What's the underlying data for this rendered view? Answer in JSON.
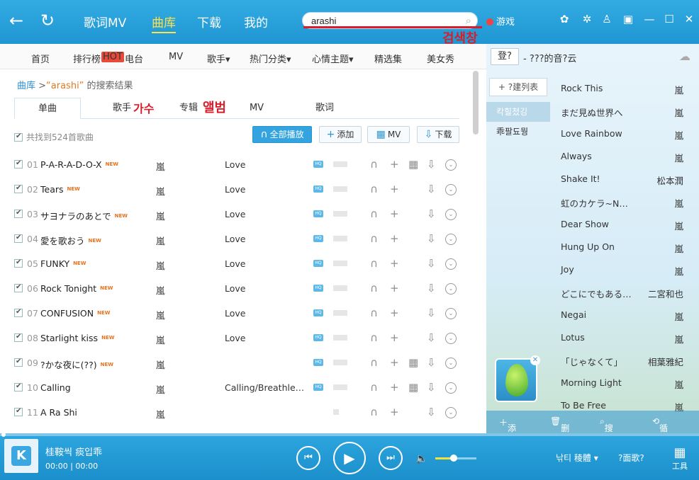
{
  "topbar": {
    "tabs": [
      "歌词MV",
      "曲库",
      "下载",
      "我的"
    ],
    "active_tab": "曲库",
    "search_value": "arashi",
    "annotation_search": "검색창",
    "games_label": "游戏"
  },
  "category_nav": [
    "首页",
    "排行榜",
    "电台",
    "MV",
    "歌手▾",
    "热门分类▾",
    "心情主题▾",
    "精选集",
    "美女秀"
  ],
  "hot_badge": "HOT",
  "breadcrumb": {
    "root": "曲库",
    "sep": " >",
    "keyword": "“arashi”",
    "suffix": " 的搜索结果"
  },
  "sub_tabs": [
    "单曲",
    "歌手",
    "专辑",
    "MV",
    "歌词"
  ],
  "annotation_artist": "가수",
  "annotation_album": "앨범",
  "toolbar": {
    "found": "共找到524首歌曲",
    "play_all": "全部播放",
    "add": "添加",
    "mv": "MV",
    "download": "下载"
  },
  "new_label": "NEW",
  "hq_label": "HQ",
  "songs": [
    {
      "num": "01",
      "title": "P-A-R-A-D-O-X",
      "new": true,
      "artist": "嵐",
      "album": "Love"
    },
    {
      "num": "02",
      "title": "Tears",
      "new": true,
      "artist": "嵐",
      "album": "Love"
    },
    {
      "num": "03",
      "title": "サヨナラのあとで",
      "new": true,
      "artist": "嵐",
      "album": "Love"
    },
    {
      "num": "04",
      "title": "愛を歌おう",
      "new": true,
      "artist": "嵐",
      "album": "Love"
    },
    {
      "num": "05",
      "title": "FUNKY",
      "new": true,
      "artist": "嵐",
      "album": "Love"
    },
    {
      "num": "06",
      "title": "Rock Tonight",
      "new": true,
      "artist": "嵐",
      "album": "Love"
    },
    {
      "num": "07",
      "title": "CONFUSION",
      "new": true,
      "artist": "嵐",
      "album": "Love"
    },
    {
      "num": "08",
      "title": "Starlight kiss",
      "new": true,
      "artist": "嵐",
      "album": "Love"
    },
    {
      "num": "09",
      "title": "?かな夜に(??)",
      "new": true,
      "artist": "嵐",
      "album": ""
    },
    {
      "num": "10",
      "title": "Calling",
      "new": false,
      "artist": "嵐",
      "album": "Calling/Breathle…"
    },
    {
      "num": "11",
      "title": "A Ra Shi",
      "new": false,
      "artist": "嵐",
      "album": ""
    }
  ],
  "right_panel": {
    "login": "登?",
    "title": "- ???的音?云",
    "new_list": "?建列表",
    "lists": [
      "칵힐첬깅",
      "乖팔됴뭥"
    ],
    "tracks": [
      {
        "title": "Rock This",
        "artist": "嵐"
      },
      {
        "title": "まだ見ぬ世界へ",
        "artist": "嵐"
      },
      {
        "title": "Love Rainbow",
        "artist": "嵐"
      },
      {
        "title": "Always",
        "artist": "嵐"
      },
      {
        "title": "Shake It!",
        "artist": "松本潤"
      },
      {
        "title": "虹のカケラ~N…",
        "artist": "嵐"
      },
      {
        "title": "Dear Show",
        "artist": "嵐"
      },
      {
        "title": "Hung Up On",
        "artist": "嵐"
      },
      {
        "title": "Joy",
        "artist": "嵐"
      },
      {
        "title": "どこにでもある…",
        "artist": "二宮和也"
      },
      {
        "title": "Negai",
        "artist": "嵐"
      },
      {
        "title": "Lotus",
        "artist": "嵐"
      },
      {
        "title": "「じゃなくて」",
        "artist": "相葉雅紀"
      },
      {
        "title": "Morning Light",
        "artist": "嵐"
      },
      {
        "title": "To Be Free",
        "artist": "嵐"
      }
    ],
    "footer": [
      "添加",
      "删除",
      "搜索",
      "循环"
    ]
  },
  "player": {
    "title": "桂鞍씩 痰입乖",
    "time": "00:00 | 00:00",
    "volume_level": 0.45,
    "quality": "낚티 稜體 ▾",
    "lyrics": "?面歌?",
    "tools": "工具"
  },
  "colors": {
    "accent": "#1f96d2",
    "active_tab": "#ffe14a",
    "annotation": "#d81e2a",
    "new_badge": "#e9711c"
  }
}
